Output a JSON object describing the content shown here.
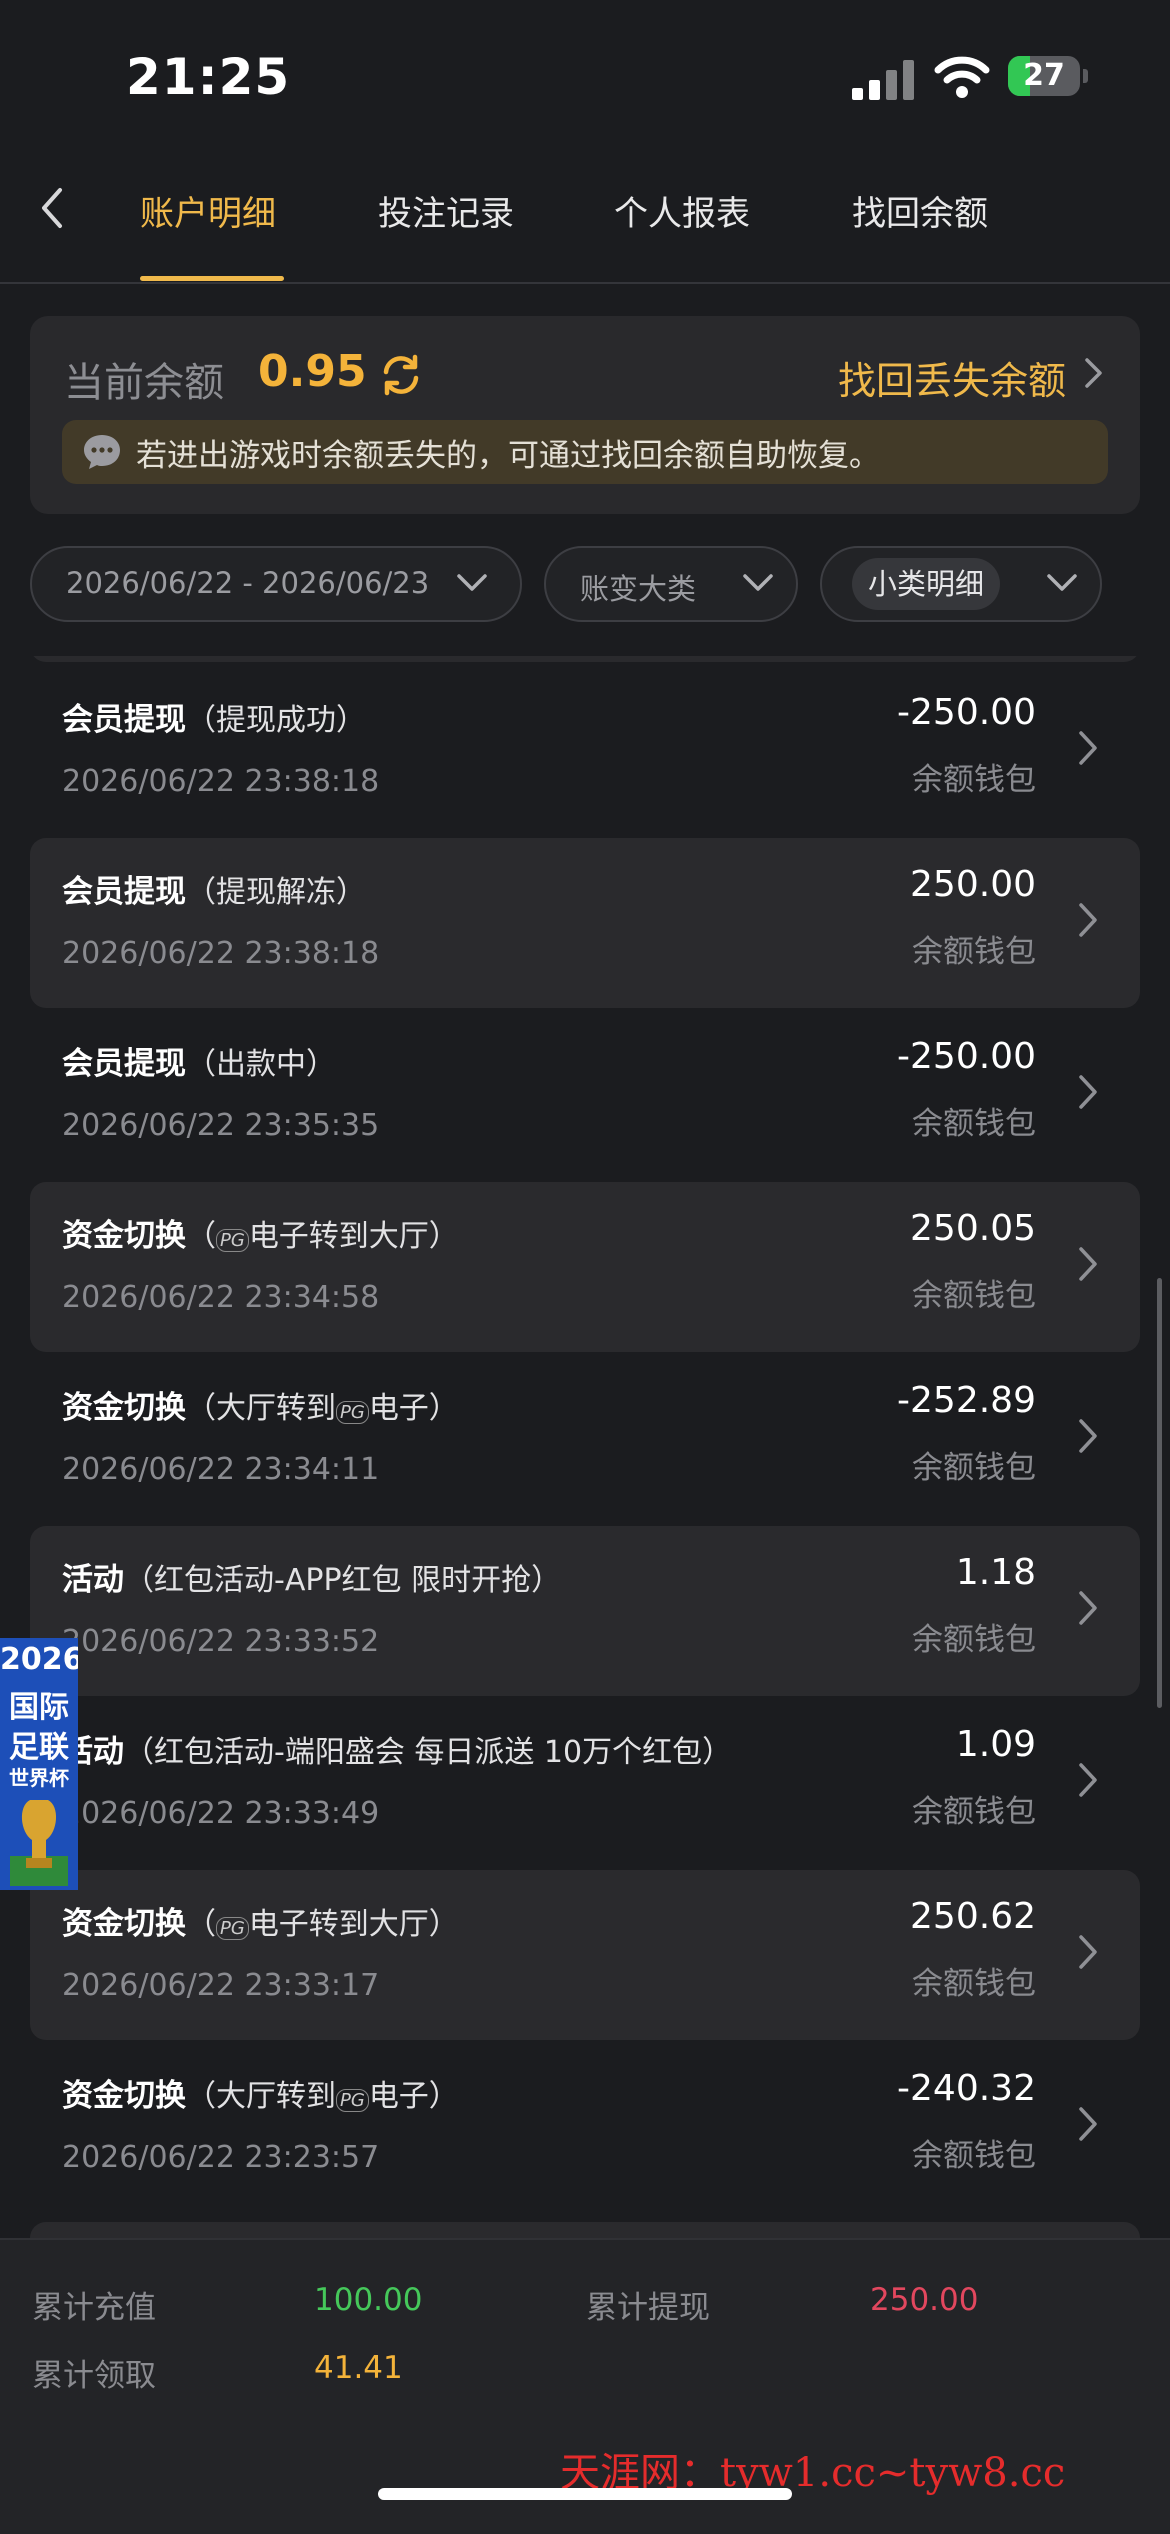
{
  "status_bar": {
    "time": "21:25",
    "battery": "27"
  },
  "tabs": [
    {
      "label": "账户明细",
      "active": true
    },
    {
      "label": "投注记录",
      "active": false
    },
    {
      "label": "个人报表",
      "active": false
    },
    {
      "label": "找回余额",
      "active": false
    }
  ],
  "balance": {
    "label": "当前余额",
    "value": "0.95",
    "recover_link": "找回丢失余额",
    "notice": "若进出游戏时余额丢失的，可通过找回余额自助恢复。"
  },
  "filters": {
    "date_range": "2026/06/22 - 2026/06/23",
    "category": "账变大类",
    "subcategory": "小类明细"
  },
  "transactions": [
    {
      "title": "会员提现",
      "detail_prefix": "（提现成功）",
      "detail_suffix": "",
      "date": "2026/06/22 23:38:18",
      "amount": "-250.00",
      "wallet": "余额钱包"
    },
    {
      "title": "会员提现",
      "detail_prefix": "（提现解冻）",
      "detail_suffix": "",
      "date": "2026/06/22 23:38:18",
      "amount": "250.00",
      "wallet": "余额钱包"
    },
    {
      "title": "会员提现",
      "detail_prefix": "（出款中）",
      "detail_suffix": "",
      "date": "2026/06/22 23:35:35",
      "amount": "-250.00",
      "wallet": "余额钱包"
    },
    {
      "title": "资金切换",
      "detail_prefix": "（",
      "detail_suffix": "电子转到大厅）",
      "date": "2026/06/22 23:34:58",
      "amount": "250.05",
      "wallet": "余额钱包"
    },
    {
      "title": "资金切换",
      "detail_prefix": "（大厅转到",
      "detail_suffix": "电子）",
      "date": "2026/06/22 23:34:11",
      "amount": "-252.89",
      "wallet": "余额钱包"
    },
    {
      "title": "活动",
      "detail_prefix": "（红包活动-APP红包 限时开抢）",
      "detail_suffix": "",
      "date": "2026/06/22 23:33:52",
      "amount": "1.18",
      "wallet": "余额钱包"
    },
    {
      "title": "活动",
      "detail_prefix": "（红包活动-端阳盛会 每日派送 10万个红包）",
      "detail_suffix": "",
      "date": "2026/06/22 23:33:49",
      "amount": "1.09",
      "wallet": "余额钱包"
    },
    {
      "title": "资金切换",
      "detail_prefix": "（",
      "detail_suffix": "电子转到大厅）",
      "date": "2026/06/22 23:33:17",
      "amount": "250.62",
      "wallet": "余额钱包"
    },
    {
      "title": "资金切换",
      "detail_prefix": "（大厅转到",
      "detail_suffix": "电子）",
      "date": "2026/06/22 23:23:57",
      "amount": "-240.32",
      "wallet": "余额钱包"
    }
  ],
  "pg_logo": "PG",
  "summary": {
    "recharge_label": "累计充值",
    "recharge_value": "100.00",
    "withdraw_label": "累计提现",
    "withdraw_value": "250.00",
    "claim_label": "累计领取",
    "claim_value": "41.41"
  },
  "promo": {
    "line1": "2026",
    "line2": "国际",
    "line3": "足联",
    "line4": "世界杯"
  },
  "watermark": "天涯网：tyw1.cc~tyw8.cc",
  "colors": {
    "accent": "#f0b94b",
    "balance": "#f4b33a",
    "recharge": "#45c85a",
    "withdraw": "#e2475e",
    "claim": "#f4b33a"
  }
}
